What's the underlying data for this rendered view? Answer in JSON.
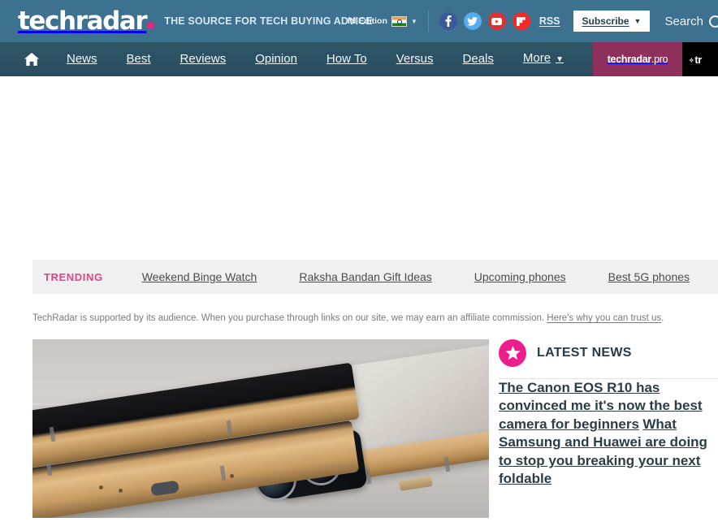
{
  "topbar": {
    "logo_text": "techradar",
    "tagline": "THE SOURCE FOR TECH BUYING ADVICE",
    "edition_label": "IN Edition",
    "edition_caret": "▼",
    "rss_label": "RSS",
    "subscribe_label": "Subscribe",
    "subscribe_caret": "▼",
    "search_label": "Search",
    "socials": [
      {
        "name": "facebook-icon",
        "glyph": "f"
      },
      {
        "name": "twitter-icon",
        "glyph": "t"
      },
      {
        "name": "youtube-icon",
        "glyph": "▶"
      },
      {
        "name": "flipboard-icon",
        "glyph": "F"
      }
    ],
    "colors": {
      "background": "#3d7190",
      "logo_dot": "#e6297b",
      "facebook": "#3b5998",
      "twitter": "#55acee",
      "youtube": "#e02f2f",
      "flipboard": "#f52828"
    }
  },
  "nav": {
    "home_icon": "home-icon",
    "items": [
      {
        "label": "News"
      },
      {
        "label": "Best"
      },
      {
        "label": "Reviews"
      },
      {
        "label": "Opinion"
      },
      {
        "label": "How To"
      },
      {
        "label": "Versus"
      },
      {
        "label": "Deals"
      },
      {
        "label": "More"
      }
    ],
    "more_caret": "▼",
    "pro_brand_bold": "techradar",
    "pro_brand_light": ".pro",
    "partner_text": "tr",
    "partner_diamond": "✧",
    "colors": {
      "background": "#2e5568",
      "pro_block": "#8f2f5c",
      "partner_block": "#000000"
    }
  },
  "trending": {
    "label": "TRENDING",
    "items": [
      {
        "label": "Weekend Binge Watch"
      },
      {
        "label": "Raksha Bandan Gift Ideas"
      },
      {
        "label": "Upcoming phones"
      },
      {
        "label": "Best 5G phones"
      }
    ],
    "label_color": "#ec3f86",
    "background": "#f0f0f0"
  },
  "disclosure": {
    "text": "TechRadar is supported by its audience. When you purchase through links on our site, we may earn an affiliate commission. ",
    "link_text": "Here's why you can trust us",
    "period": "."
  },
  "hero": {
    "alt": "gold foldable smartphones stacked on a pale surface"
  },
  "sidebar": {
    "section_title": "LATEST NEWS",
    "star_icon": "star-icon",
    "badge_color": "#ec1e8c",
    "articles": [
      {
        "headline": "The Canon EOS R10 has convinced me it's now the best camera for beginners"
      },
      {
        "headline": "What Samsung and Huawei are doing to stop you breaking your next foldable"
      }
    ]
  }
}
